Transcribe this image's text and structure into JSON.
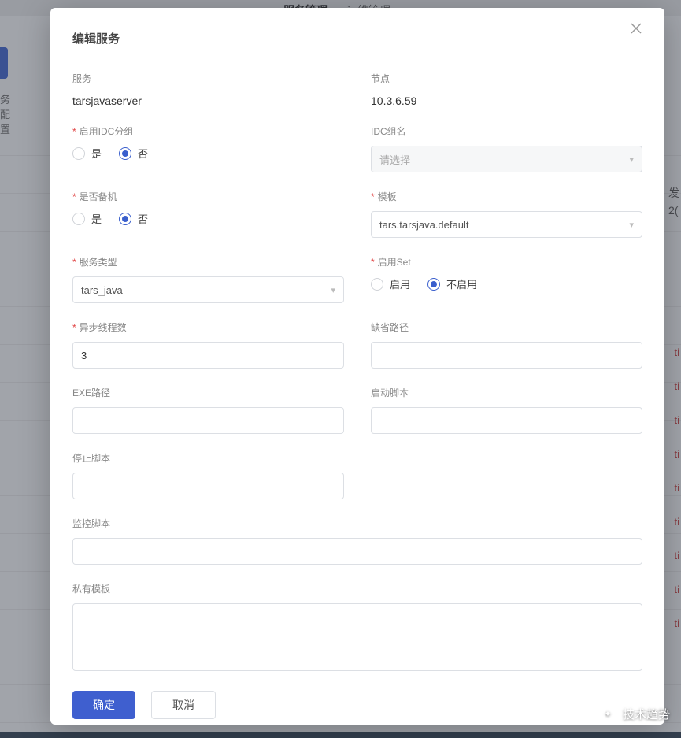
{
  "background": {
    "nav": {
      "active": "服务管理",
      "other": "运维管理"
    },
    "sideText": "务配置",
    "rightTop": "发",
    "rightNumHint": "2(",
    "rightActions": [
      "ti",
      "ti",
      "ti",
      "ti",
      "ti",
      "ti",
      "ti",
      "ti",
      "ti"
    ]
  },
  "modal": {
    "title": "编辑服务",
    "fields": {
      "service": {
        "label": "服务",
        "value": "tarsjavaserver"
      },
      "node": {
        "label": "节点",
        "value": "10.3.6.59"
      },
      "enable_idc": {
        "label": "启用IDC分组",
        "options": {
          "yes": "是",
          "no": "否"
        },
        "selected": "no"
      },
      "idc_name": {
        "label": "IDC组名",
        "placeholder": "请选择",
        "value": ""
      },
      "is_backup": {
        "label": "是否备机",
        "options": {
          "yes": "是",
          "no": "否"
        },
        "selected": "no"
      },
      "template": {
        "label": "模板",
        "value": "tars.tarsjava.default"
      },
      "service_type": {
        "label": "服务类型",
        "value": "tars_java"
      },
      "enable_set": {
        "label": "启用Set",
        "options": {
          "enable": "启用",
          "disable": "不启用"
        },
        "selected": "disable"
      },
      "async_threads": {
        "label": "异步线程数",
        "value": "3"
      },
      "default_path": {
        "label": "缺省路径",
        "value": ""
      },
      "exe_path": {
        "label": "EXE路径",
        "value": ""
      },
      "start_script": {
        "label": "启动脚本",
        "value": ""
      },
      "stop_script": {
        "label": "停止脚本",
        "value": ""
      },
      "monitor_script": {
        "label": "监控脚本",
        "value": ""
      },
      "private_template": {
        "label": "私有模板",
        "value": ""
      }
    },
    "buttons": {
      "confirm": "确定",
      "cancel": "取消"
    }
  },
  "watermark": {
    "text": "技术趋势"
  }
}
